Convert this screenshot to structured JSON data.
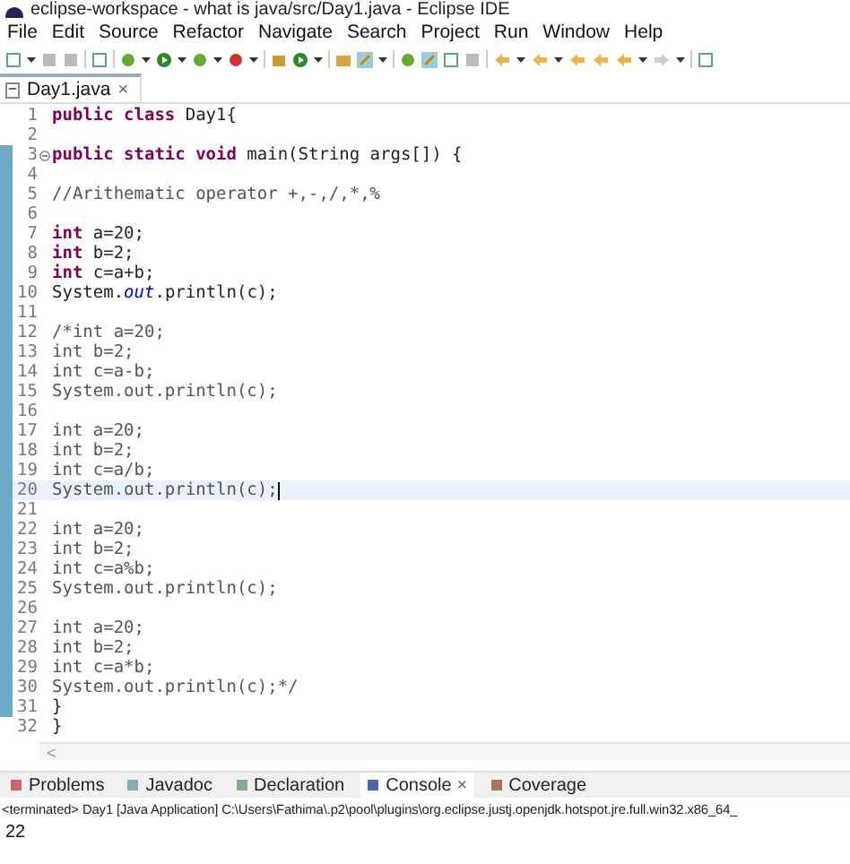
{
  "window": {
    "title": "eclipse-workspace - what is java/src/Day1.java - Eclipse IDE"
  },
  "menu": [
    "File",
    "Edit",
    "Source",
    "Refactor",
    "Navigate",
    "Search",
    "Project",
    "Run",
    "Window",
    "Help"
  ],
  "editor_tabs": [
    {
      "label": "Day1.java",
      "close": "×",
      "selected": true
    }
  ],
  "code_lines": [
    {
      "number": "1",
      "segments": [
        {
          "kind": "keyword",
          "text": "public class"
        },
        {
          "kind": "plain",
          "text": " Day1{"
        }
      ]
    },
    {
      "number": "2"
    },
    {
      "number": "3",
      "folded": false,
      "segments": [
        {
          "kind": "keyword",
          "text": "public static void"
        },
        {
          "kind": "plain",
          "text": " main(String args[]) {"
        }
      ]
    },
    {
      "number": "4"
    },
    {
      "number": "5",
      "segments": [
        {
          "kind": "comment",
          "text": "//Arithematic operator +,-,/,*,%"
        }
      ]
    },
    {
      "number": "6"
    },
    {
      "number": "7",
      "segments": [
        {
          "kind": "keyword",
          "text": "int"
        },
        {
          "kind": "plain",
          "text": " a=20;"
        }
      ]
    },
    {
      "number": "8",
      "segments": [
        {
          "kind": "keyword",
          "text": "int"
        },
        {
          "kind": "plain",
          "text": " b=2;"
        }
      ]
    },
    {
      "number": "9",
      "segments": [
        {
          "kind": "keyword",
          "text": "int"
        },
        {
          "kind": "plain",
          "text": " c=a+b;"
        }
      ]
    },
    {
      "number": "10",
      "segments": [
        {
          "kind": "plain",
          "text": "System."
        },
        {
          "kind": "field",
          "text": "out"
        },
        {
          "kind": "plain",
          "text": ".println(c);"
        }
      ]
    },
    {
      "number": "11"
    },
    {
      "number": "12",
      "segments": [
        {
          "kind": "comment",
          "text": "/*int a=20;"
        }
      ]
    },
    {
      "number": "13",
      "segments": [
        {
          "kind": "comment",
          "text": "int b=2;"
        }
      ]
    },
    {
      "number": "14",
      "segments": [
        {
          "kind": "comment",
          "text": "int c=a-b;"
        }
      ]
    },
    {
      "number": "15",
      "segments": [
        {
          "kind": "comment",
          "text": "System.out.println(c);"
        }
      ]
    },
    {
      "number": "16"
    },
    {
      "number": "17",
      "segments": [
        {
          "kind": "comment",
          "text": "int a=20;"
        }
      ]
    },
    {
      "number": "18",
      "segments": [
        {
          "kind": "comment",
          "text": "int b=2;"
        }
      ]
    },
    {
      "number": "19",
      "segments": [
        {
          "kind": "comment",
          "text": "int c=a/b;"
        }
      ]
    },
    {
      "number": "20",
      "current": true,
      "segments": [
        {
          "kind": "comment",
          "text": "System.out.println(c);"
        }
      ]
    },
    {
      "number": "21"
    },
    {
      "number": "22",
      "segments": [
        {
          "kind": "comment",
          "text": "int a=20;"
        }
      ]
    },
    {
      "number": "23",
      "segments": [
        {
          "kind": "comment",
          "text": "int b=2;"
        }
      ]
    },
    {
      "number": "24",
      "segments": [
        {
          "kind": "comment",
          "text": "int c=a%b;"
        }
      ]
    },
    {
      "number": "25",
      "segments": [
        {
          "kind": "comment",
          "text": "System.out.println(c);"
        }
      ]
    },
    {
      "number": "26"
    },
    {
      "number": "27",
      "segments": [
        {
          "kind": "comment",
          "text": "int a=20;"
        }
      ]
    },
    {
      "number": "28",
      "segments": [
        {
          "kind": "comment",
          "text": "int b=2;"
        }
      ]
    },
    {
      "number": "29",
      "segments": [
        {
          "kind": "comment",
          "text": "int c=a*b;"
        }
      ]
    },
    {
      "number": "30",
      "segments": [
        {
          "kind": "comment",
          "text": "System.out.println(c);*/"
        }
      ]
    },
    {
      "number": "31",
      "segments": [
        {
          "kind": "plain",
          "text": "}"
        }
      ]
    },
    {
      "number": "32",
      "segments": [
        {
          "kind": "plain",
          "text": "}"
        }
      ]
    }
  ],
  "scroll_arrow": "<",
  "bottom_tabs": [
    {
      "label": "Problems",
      "selected": false
    },
    {
      "label": "Javadoc",
      "selected": false
    },
    {
      "label": "Declaration",
      "selected": false
    },
    {
      "label": "Console",
      "close": "×",
      "selected": true
    },
    {
      "label": "Coverage",
      "selected": false
    }
  ],
  "console": {
    "header": "<terminated> Day1 [Java Application] C:\\Users\\Fathima\\.p2\\pool\\plugins\\org.eclipse.justj.openjdk.hotspot.jre.full.win32.x86_64_",
    "output": "22"
  }
}
